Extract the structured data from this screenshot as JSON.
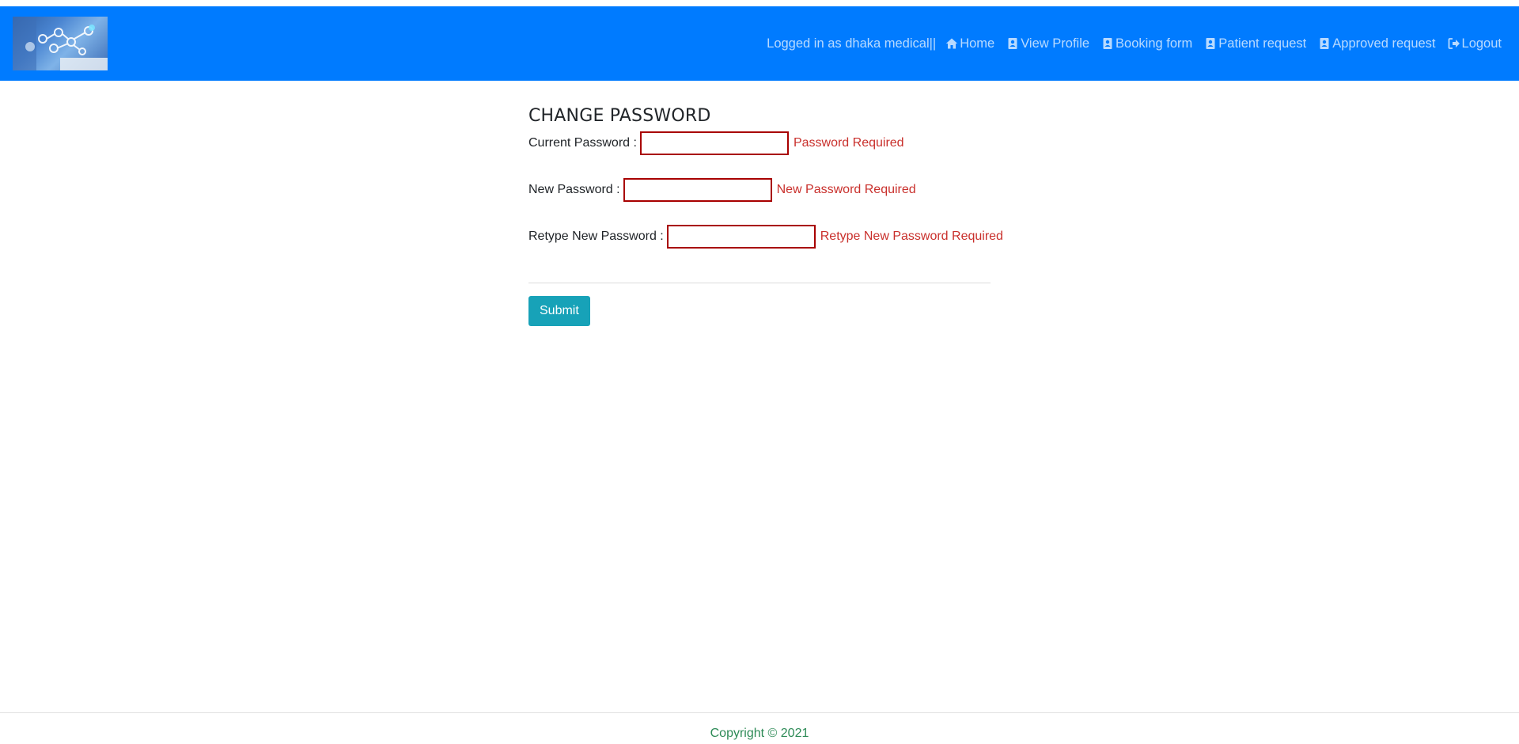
{
  "header": {
    "status_text": "Logged in as dhaka medical||",
    "nav": [
      {
        "label": "Home",
        "icon": "home-icon"
      },
      {
        "label": "View Profile",
        "icon": "profile-card-icon"
      },
      {
        "label": "Booking form",
        "icon": "profile-card-icon"
      },
      {
        "label": "Patient request",
        "icon": "profile-card-icon"
      },
      {
        "label": "Approved request",
        "icon": "profile-card-icon"
      },
      {
        "label": "Logout",
        "icon": "sign-out-icon"
      }
    ],
    "bar_color": "#007bff"
  },
  "form": {
    "title": "CHANGE PASSWORD",
    "fields": [
      {
        "label": "Current Password :",
        "value": "",
        "error": "Password Required"
      },
      {
        "label": "New Password :",
        "value": "",
        "error": "New Password Required"
      },
      {
        "label": "Retype New Password :",
        "value": "",
        "error": "Retype New Password Required"
      }
    ],
    "submit_label": "Submit",
    "submit_color": "#17a2b8",
    "error_color": "#c9302c"
  },
  "footer": {
    "copyright": "Copyright © 2021"
  }
}
